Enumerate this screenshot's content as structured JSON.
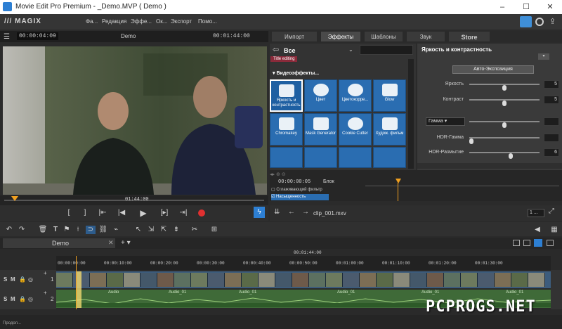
{
  "window": {
    "title": "Movie Edit Pro Premium - _Demo.MVP ( Demo )",
    "minimize": "–",
    "maximize": "☐",
    "close": "✕"
  },
  "menu": {
    "logo": "/// MAGIX",
    "items": [
      "Фа...",
      "Редакция",
      "Эффе...",
      "Ок...",
      "Экспорт",
      "Помо..."
    ]
  },
  "player": {
    "timecode_left": "00:00:04:09",
    "title": "Demo",
    "timecode_right": "00:01:44:00",
    "scrub_time": "01:44:00"
  },
  "right_tabs": [
    "Импорт",
    "Эффекты",
    "Шаблоны",
    "Звук",
    "Store"
  ],
  "effects": {
    "category": "Все",
    "title_editing_badge": "Title editing",
    "section": "Видеоэффекты...",
    "tiles": [
      {
        "label": "Яркость и контрастность"
      },
      {
        "label": "Цвет"
      },
      {
        "label": "Цветокорре..."
      },
      {
        "label": "Glow"
      },
      {
        "label": "Chromakey"
      },
      {
        "label": "Mask Generator"
      },
      {
        "label": "Cookie Cutter"
      },
      {
        "label": "Худож. фильм"
      }
    ],
    "mini_timeline": {
      "timecode": "00:00:00:05",
      "block_label": "Блок",
      "track1": "Сглаживающий фильтр",
      "track2": "Насыщенность"
    }
  },
  "properties": {
    "title": "Яркость и контрастность",
    "auto_exposure_button": "Авто-Экспозиция",
    "brightness_label": "Яркость",
    "brightness_value": "5",
    "brightness_level": 0.5,
    "contrast_label": "Контраст",
    "contrast_value": "5",
    "contrast_level": 0.5,
    "gamma_select": "Гамма",
    "gamma_level": 0.5,
    "hdr_gamma_label": "HDR-Гамма",
    "hdr_gamma_level": 0.0,
    "hdr_blur_label": "HDR-Размытие",
    "hdr_blur_value": "6",
    "hdr_blur_level": 0.6
  },
  "clip_bar": {
    "clip_name": "clip_001.mxv",
    "zoom_value": "1 ..."
  },
  "timeline": {
    "project_tab": "Demo",
    "top_time": "00:01:44:00",
    "ruler": [
      "00:00:00:00",
      "00:00:10:00",
      "00:00:20:00",
      "00:00:30:00",
      "00:00:40:00",
      "00:00:50:00",
      "00:01:00:00",
      "00:01:10:00",
      "00:01:20:00",
      "00:01:30:00"
    ],
    "track1_number": "1",
    "track2_number": "2",
    "audio_labels": [
      "Audio",
      "Audio_01",
      "Audio_01",
      "Audio_01",
      "Audio_01",
      "Audio_01"
    ],
    "status_text": "Продол..."
  },
  "watermark": "PCPROGS.NET",
  "colors": {
    "accent_blue": "#2a6db1",
    "active_blue": "#2d7fd3",
    "playhead_orange": "#f0a020",
    "record_red": "#e03030",
    "video_track": "#3c5c7c",
    "audio_track": "#3f6a38"
  }
}
